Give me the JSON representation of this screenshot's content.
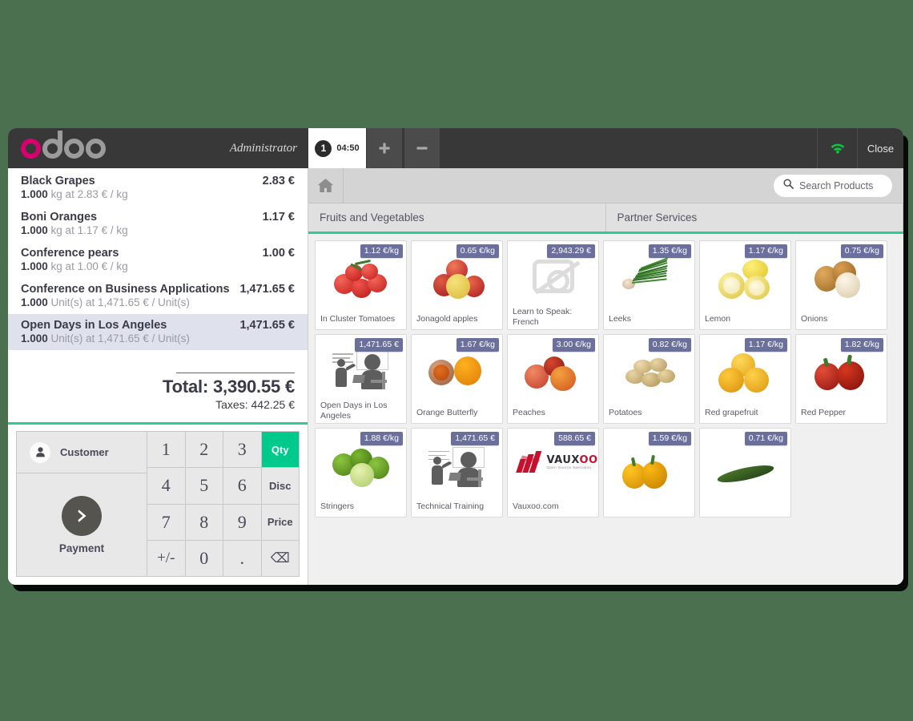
{
  "window": {
    "background_color": "#4a7050",
    "accent_green": "#2ecc93",
    "badge_color": "#6a6f9c"
  },
  "topbar": {
    "brand": "odoo",
    "user_name": "Administrator",
    "order_tab": {
      "number": "1",
      "time": "04:50"
    },
    "add_order_label": "+",
    "remove_order_label": "–",
    "wifi_icon": "wifi-icon",
    "close_label": "Close"
  },
  "order": {
    "lines": [
      {
        "name": "Black Grapes",
        "price": "2.83 €",
        "qty": "1.000",
        "detail": " kg at 2.83 € / kg",
        "selected": false
      },
      {
        "name": "Boni Oranges",
        "price": "1.17 €",
        "qty": "1.000",
        "detail": " kg at 1.17 € / kg",
        "selected": false
      },
      {
        "name": "Conference pears",
        "price": "1.00 €",
        "qty": "1.000",
        "detail": " kg at 1.00 € / kg",
        "selected": false
      },
      {
        "name": "Conference on Business Applications",
        "price": "1,471.65 €",
        "qty": "1.000",
        "detail": " Unit(s) at 1,471.65 € / Unit(s)",
        "selected": false
      },
      {
        "name": "Open Days in Los Angeles",
        "price": "1,471.65 €",
        "qty": "1.000",
        "detail": " Unit(s) at 1,471.65 € / Unit(s)",
        "selected": true
      }
    ],
    "total_label": "Total: 3,390.55 €",
    "taxes_label": "Taxes: 442.25 €"
  },
  "actions": {
    "customer_label": "Customer",
    "payment_label": "Payment"
  },
  "numpad": {
    "keys": [
      "1",
      "2",
      "3",
      "4",
      "5",
      "6",
      "7",
      "8",
      "9",
      "+/-",
      "0",
      "."
    ],
    "qty_label": "Qty",
    "disc_label": "Disc",
    "price_label": "Price",
    "backspace_label": "⌫",
    "active_mode": "Qty"
  },
  "search": {
    "placeholder": "Search Products",
    "value": "",
    "icon": "search-icon",
    "home_icon": "home-icon"
  },
  "categories": [
    {
      "label": "Fruits and Vegetables"
    },
    {
      "label": "Partner Services"
    }
  ],
  "products": [
    {
      "name": "In Cluster Tomatoes",
      "price": "1.12 €/kg",
      "art": "tomatoes"
    },
    {
      "name": "Jonagold apples",
      "price": "0.65 €/kg",
      "art": "apples"
    },
    {
      "name": "Learn to Speak: French",
      "price": "2,943.29 €",
      "art": "placeholder"
    },
    {
      "name": "Leeks",
      "price": "1.35 €/kg",
      "art": "leeks"
    },
    {
      "name": "Lemon",
      "price": "1.17 €/kg",
      "art": "lemon"
    },
    {
      "name": "Onions",
      "price": "0.75 €/kg",
      "art": "onions"
    },
    {
      "name": "Open Days in Los Angeles",
      "price": "1,471.65 €",
      "art": "training"
    },
    {
      "name": "Orange Butterfly",
      "price": "1.67 €/kg",
      "art": "orange"
    },
    {
      "name": "Peaches",
      "price": "3.00 €/kg",
      "art": "peaches"
    },
    {
      "name": "Potatoes",
      "price": "0.82 €/kg",
      "art": "potatoes"
    },
    {
      "name": "Red grapefruit",
      "price": "1.17 €/kg",
      "art": "grapefruit"
    },
    {
      "name": "Red Pepper",
      "price": "1.82 €/kg",
      "art": "redpepper"
    },
    {
      "name": "Stringers",
      "price": "1.88 €/kg",
      "art": "limes"
    },
    {
      "name": "Technical Training",
      "price": "1,471.65 €",
      "art": "training"
    },
    {
      "name": "Vauxoo.com",
      "price": "588.65 €",
      "art": "vauxoo"
    },
    {
      "name": "",
      "price": "1.59 €/kg",
      "art": "yellowpepper"
    },
    {
      "name": "",
      "price": "0.71 €/kg",
      "art": "cucumber"
    }
  ]
}
